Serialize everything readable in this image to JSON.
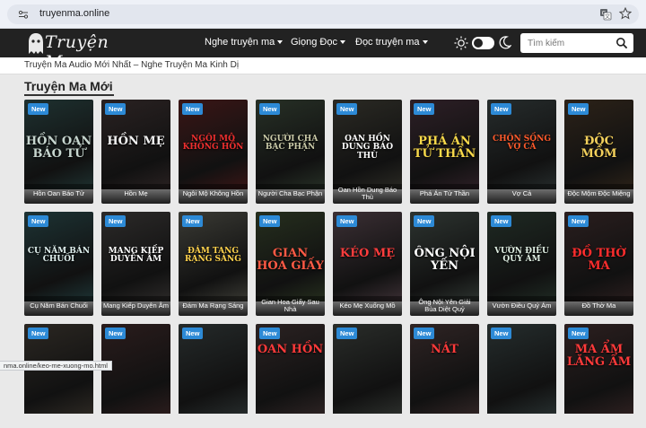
{
  "browser": {
    "url": "truyenma.online"
  },
  "header": {
    "logo_text": "Truyện Ma",
    "nav": [
      {
        "label": "Nghe truyện ma"
      },
      {
        "label": "Giọng Đọc"
      },
      {
        "label": "Đọc truyện ma"
      }
    ],
    "search_placeholder": "Tìm kiếm"
  },
  "sub_header": {
    "text": "Truyện Ma Audio Mới Nhất – Nghe Truyện Ma Kinh Dị"
  },
  "section": {
    "title": "Truyện Ma Mới",
    "badge": "New"
  },
  "cards": [
    {
      "caption": "Hồn Oan Báo Tử",
      "art": "HỒN OAN BÁO TỬ",
      "bg": "#1e3130",
      "art_color": "#c7d6cf"
    },
    {
      "caption": "Hồn Mẹ",
      "art": "HỒN MẸ",
      "bg": "#2a2222",
      "art_color": "#f2f2f2"
    },
    {
      "caption": "Ngôi Mộ Không Hồn",
      "art": "NGÔI MỘ KHÔNG HỒN",
      "bg": "#3a1616",
      "art_color": "#ee2f2f"
    },
    {
      "caption": "Người Cha Bạc Phận",
      "art": "NGƯỜI CHA BẠC PHẬN",
      "bg": "#273026",
      "art_color": "#c9c9a7"
    },
    {
      "caption": "Oan Hồn Dung Báo Thù",
      "art": "OAN HỒN DUNG BÁO THÙ",
      "bg": "#2b2a24",
      "art_color": "#ffffff"
    },
    {
      "caption": "Phá Án Tử Thần",
      "art": "PHÁ ÁN TỬ THẦN",
      "bg": "#2d1f26",
      "art_color": "#f7d84a"
    },
    {
      "caption": "Vợ Cả",
      "art": "CHÔN SỐNG VỢ CẢ",
      "bg": "#262c2c",
      "art_color": "#ff5a2b"
    },
    {
      "caption": "Độc Mộm Độc Miệng",
      "art": "ĐỘC MỒM",
      "bg": "#2c2218",
      "art_color": "#f3d05c"
    },
    {
      "caption": "Cụ Năm Bán Chuối",
      "art": "CỤ NĂM BÁN CHUỐI",
      "bg": "#1d3334",
      "art_color": "#e0f0ee"
    },
    {
      "caption": "Mang Kiếp Duyên Âm",
      "art": "MANG KIẾP DUYÊN ÂM",
      "bg": "#2c2a29",
      "art_color": "#ffffff"
    },
    {
      "caption": "Đám Ma Rạng Sáng",
      "art": "ĐÁM TANG RẠNG SÁNG",
      "bg": "#3a3a34",
      "art_color": "#ffd34d"
    },
    {
      "caption": "Gian Hoa Giấy Sau Nhà",
      "art": "GIAN HOA GIẤY",
      "bg": "#262f1e",
      "art_color": "#ff5a45"
    },
    {
      "caption": "Kéo Mẹ Xuống Mồ",
      "art": "KÉO MẸ",
      "bg": "#3b2f34",
      "art_color": "#ff3d3d"
    },
    {
      "caption": "Ông Nội Yên Giải Bùa Diệt Quỷ",
      "art": "ÔNG NỘI YẾN",
      "bg": "#2d3430",
      "art_color": "#ffffff"
    },
    {
      "caption": "Vườn Điều Quỷ Ám",
      "art": "VƯỜN ĐIỀU QUỶ ÁM",
      "bg": "#1f2a23",
      "art_color": "#dfeee2"
    },
    {
      "caption": "Đồ Thờ Ma",
      "art": "ĐỒ THỜ MA",
      "bg": "#2a1e1e",
      "art_color": "#ff2d2d"
    },
    {
      "caption": "",
      "art": "",
      "bg": "#2b2722",
      "art_color": "#ffffff"
    },
    {
      "caption": "",
      "art": "",
      "bg": "#2a1c1c",
      "art_color": "#ff3a3a"
    },
    {
      "caption": "",
      "art": "",
      "bg": "#252a2a",
      "art_color": "#ffffff"
    },
    {
      "caption": "",
      "art": "OAN HỒN",
      "bg": "#2b2222",
      "art_color": "#ff3a3a"
    },
    {
      "caption": "",
      "art": "",
      "bg": "#2a2d2a",
      "art_color": "#ffffff"
    },
    {
      "caption": "",
      "art": "NÁT",
      "bg": "#2f2424",
      "art_color": "#ff3a3a"
    },
    {
      "caption": "",
      "art": "",
      "bg": "#252d2d",
      "art_color": "#ffffff"
    },
    {
      "caption": "",
      "art": "MA ẨM LĂNG ẨM",
      "bg": "#2c1f1f",
      "art_color": "#ff3a3a"
    }
  ],
  "status_url": "nma.online/keo-me-xuong-mo.html"
}
